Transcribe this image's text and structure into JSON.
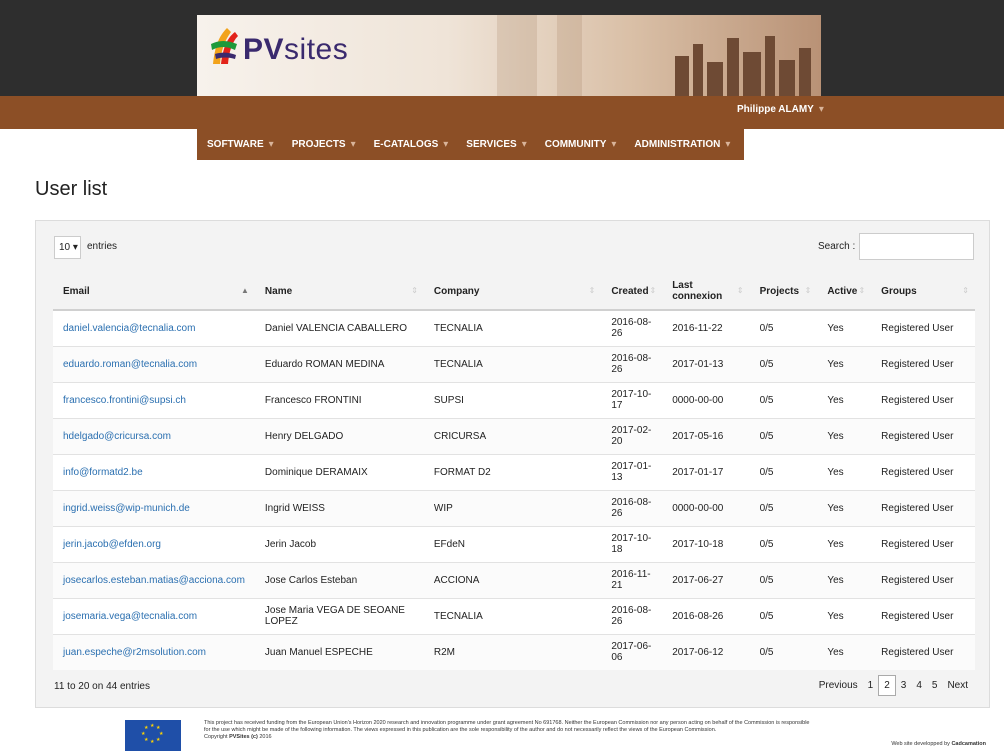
{
  "header": {
    "logo_prefix": "PV",
    "logo_suffix": "sites",
    "user_name": "Philippe ALAMY",
    "nav": [
      {
        "label": "SOFTWARE"
      },
      {
        "label": "PROJECTS"
      },
      {
        "label": "E-CATALOGS"
      },
      {
        "label": "SERVICES"
      },
      {
        "label": "COMMUNITY"
      },
      {
        "label": "ADMINISTRATION"
      }
    ],
    "colors": {
      "dark": "#2e2e2e",
      "brown": "#8c4f26",
      "logo": "#3a2a6e"
    }
  },
  "page": {
    "title": "User list"
  },
  "controls": {
    "length_value": "10",
    "length_label": "entries",
    "search_label": "Search :",
    "search_value": ""
  },
  "table": {
    "columns": [
      "Email",
      "Name",
      "Company",
      "Created",
      "Last connexion",
      "Projects",
      "Active",
      "Groups"
    ],
    "rows": [
      {
        "email": "daniel.valencia@tecnalia.com",
        "name": "Daniel VALENCIA CABALLERO",
        "company": "TECNALIA",
        "created": "2016-08-26",
        "last": "2016-11-22",
        "projects": "0/5",
        "active": "Yes",
        "groups": "Registered User"
      },
      {
        "email": "eduardo.roman@tecnalia.com",
        "name": "Eduardo ROMAN MEDINA",
        "company": "TECNALIA",
        "created": "2016-08-26",
        "last": "2017-01-13",
        "projects": "0/5",
        "active": "Yes",
        "groups": "Registered User"
      },
      {
        "email": "francesco.frontini@supsi.ch",
        "name": "Francesco FRONTINI",
        "company": "SUPSI",
        "created": "2017-10-17",
        "last": "0000-00-00",
        "projects": "0/5",
        "active": "Yes",
        "groups": "Registered User"
      },
      {
        "email": "hdelgado@cricursa.com",
        "name": "Henry DELGADO",
        "company": "CRICURSA",
        "created": "2017-02-20",
        "last": "2017-05-16",
        "projects": "0/5",
        "active": "Yes",
        "groups": "Registered User"
      },
      {
        "email": "info@formatd2.be",
        "name": "Dominique DERAMAIX",
        "company": "FORMAT D2",
        "created": "2017-01-13",
        "last": "2017-01-17",
        "projects": "0/5",
        "active": "Yes",
        "groups": "Registered User"
      },
      {
        "email": "ingrid.weiss@wip-munich.de",
        "name": "Ingrid WEISS",
        "company": "WIP",
        "created": "2016-08-26",
        "last": "0000-00-00",
        "projects": "0/5",
        "active": "Yes",
        "groups": "Registered User"
      },
      {
        "email": "jerin.jacob@efden.org",
        "name": "Jerin Jacob",
        "company": "EFdeN",
        "created": "2017-10-18",
        "last": "2017-10-18",
        "projects": "0/5",
        "active": "Yes",
        "groups": "Registered User"
      },
      {
        "email": "josecarlos.esteban.matias@acciona.com",
        "name": "Jose Carlos Esteban",
        "company": "ACCIONA",
        "created": "2016-11-21",
        "last": "2017-06-27",
        "projects": "0/5",
        "active": "Yes",
        "groups": "Registered User"
      },
      {
        "email": "josemaria.vega@tecnalia.com",
        "name": "Jose Maria VEGA DE SEOANE LOPEZ",
        "company": "TECNALIA",
        "created": "2016-08-26",
        "last": "2016-08-26",
        "projects": "0/5",
        "active": "Yes",
        "groups": "Registered User"
      },
      {
        "email": "juan.espeche@r2msolution.com",
        "name": "Juan Manuel ESPECHE",
        "company": "R2M",
        "created": "2017-06-06",
        "last": "2017-06-12",
        "projects": "0/5",
        "active": "Yes",
        "groups": "Registered User"
      }
    ]
  },
  "pagination": {
    "info": "11 to 20 on 44 entries",
    "previous": "Previous",
    "pages": [
      "1",
      "2",
      "3",
      "4",
      "5"
    ],
    "current": "2",
    "next": "Next"
  },
  "footer": {
    "funding_line1": "This project has received funding from the European Union's Horizon 2020 research and innovation programme under grant agreement No 691768. Neither the European Commission nor any person acting on behalf of the Commission is responsible",
    "funding_line2": "for the use which might be made of the following information. The views expressed in this publication are the sole responsibility of the author and do not necessarily reflect the views of the European Commission.",
    "copyright_prefix": "Copyright",
    "copyright_brand": "PVSites (c)",
    "copyright_year": "2016",
    "developer_prefix": "Web site developped by",
    "developer_name": "Cadcamation"
  }
}
